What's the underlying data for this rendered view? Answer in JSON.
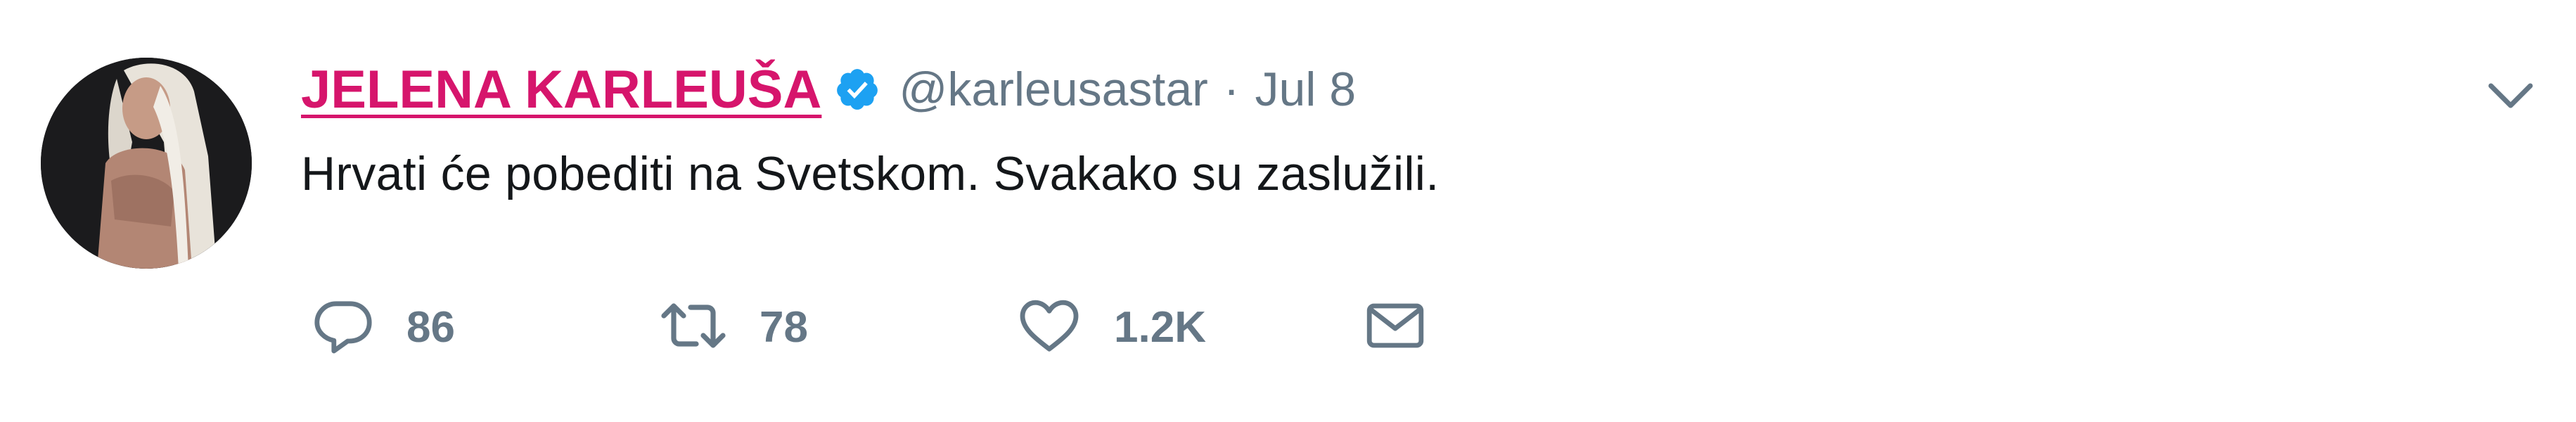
{
  "tweet": {
    "author": {
      "display_name": "JELENA KARLEUŠA",
      "handle": "@karleusastar",
      "verified": true,
      "avatar_icon": "profile-photo",
      "name_color": "#d6156c"
    },
    "separator": "·",
    "timestamp": "Jul 8",
    "text": "Hrvati će pobediti na Svetskom. Svakako su zaslužili.",
    "caret_icon": "chevron-down-icon",
    "actions": {
      "reply": {
        "icon": "reply-icon",
        "count": "86"
      },
      "retweet": {
        "icon": "retweet-icon",
        "count": "78"
      },
      "like": {
        "icon": "heart-icon",
        "count": "1.2K"
      },
      "direct_message": {
        "icon": "envelope-icon"
      }
    },
    "colors": {
      "accent_blue": "#1da1f2",
      "muted_gray": "#657786",
      "text": "#14171a"
    }
  }
}
